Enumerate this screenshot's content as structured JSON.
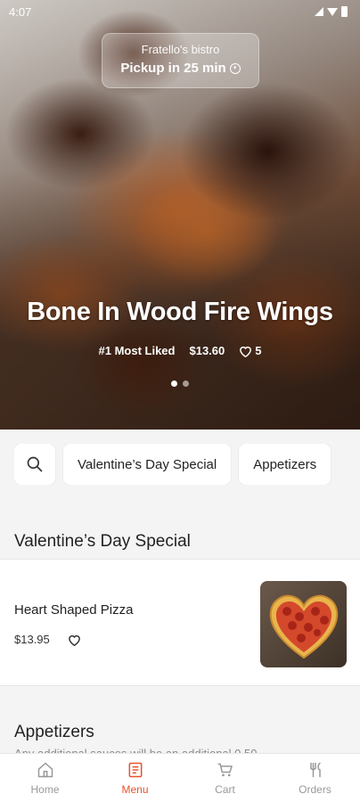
{
  "status_bar": {
    "time": "4:07"
  },
  "pickup": {
    "store_name": "Fratello's bistro",
    "time_label": "Pickup in 25 min"
  },
  "hero": {
    "title": "Bone In Wood Fire Wings",
    "badge": "#1 Most Liked",
    "price": "$13.60",
    "likes": "5",
    "slides": 2,
    "active_slide": 1
  },
  "chips": [
    {
      "label": "Valentine’s Day Special"
    },
    {
      "label": "Appetizers"
    }
  ],
  "sections": [
    {
      "title": "Valentine’s Day Special",
      "items": [
        {
          "name": "Heart Shaped Pizza",
          "price": "$13.95"
        }
      ]
    },
    {
      "title": "Appetizers",
      "description_partial": "Any additional sauces will be an additional 0.50"
    }
  ],
  "bottom_nav": [
    {
      "label": "Home",
      "icon": "home-icon",
      "active": false
    },
    {
      "label": "Menu",
      "icon": "menu-book-icon",
      "active": true
    },
    {
      "label": "Cart",
      "icon": "cart-icon",
      "active": false
    },
    {
      "label": "Orders",
      "icon": "fork-knife-icon",
      "active": false
    }
  ],
  "colors": {
    "accent": "#e8532a",
    "inactive": "#999999",
    "background": "#f4f4f4"
  }
}
